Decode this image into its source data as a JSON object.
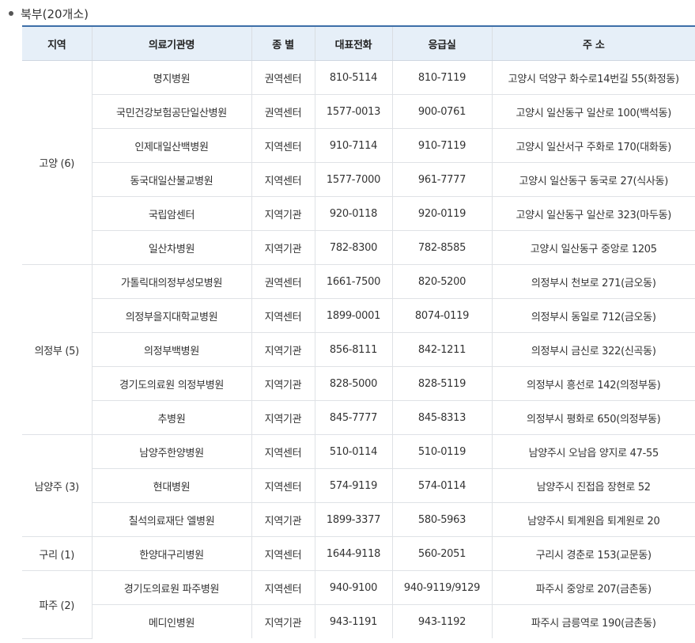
{
  "section": {
    "title": "북부(20개소)"
  },
  "table": {
    "headers": [
      "지역",
      "의료기관명",
      "종 별",
      "대표전화",
      "응급실",
      "주 소"
    ],
    "groups": [
      {
        "region": "고양 (6)",
        "rows": [
          [
            "명지병원",
            "권역센터",
            "810-5114",
            "810-7119",
            "고양시 덕양구 화수로14번길 55(화정동)"
          ],
          [
            "국민건강보험공단일산병원",
            "권역센터",
            "1577-0013",
            "900-0761",
            "고양시 일산동구 일산로 100(백석동)"
          ],
          [
            "인제대일산백병원",
            "지역센터",
            "910-7114",
            "910-7119",
            "고양시 일산서구 주화로 170(대화동)"
          ],
          [
            "동국대일산불교병원",
            "지역센터",
            "1577-7000",
            "961-7777",
            "고양시 일산동구 동국로 27(식사동)"
          ],
          [
            "국립암센터",
            "지역기관",
            "920-0118",
            "920-0119",
            "고양시 일산동구 일산로 323(마두동)"
          ],
          [
            "일산차병원",
            "지역기관",
            "782-8300",
            "782-8585",
            "고양시 일산동구 중앙로 1205"
          ]
        ]
      },
      {
        "region": "의정부 (5)",
        "rows": [
          [
            "가톨릭대의정부성모병원",
            "권역센터",
            "1661-7500",
            "820-5200",
            "의정부시 천보로 271(금오동)"
          ],
          [
            "의정부을지대학교병원",
            "지역센터",
            "1899-0001",
            "8074-0119",
            "의정부시 동일로 712(금오동)"
          ],
          [
            "의정부백병원",
            "지역기관",
            "856-8111",
            "842-1211",
            "의정부시 금신로 322(신곡동)"
          ],
          [
            "경기도의료원 의정부병원",
            "지역기관",
            "828-5000",
            "828-5119",
            "의정부시 흥선로 142(의정부동)"
          ],
          [
            "추병원",
            "지역기관",
            "845-7777",
            "845-8313",
            "의정부시 평화로 650(의정부동)"
          ]
        ]
      },
      {
        "region": "남양주 (3)",
        "rows": [
          [
            "남양주한양병원",
            "지역센터",
            "510-0114",
            "510-0119",
            "남양주시 오남읍 양지로 47-55"
          ],
          [
            "현대병원",
            "지역센터",
            "574-9119",
            "574-0114",
            "남양주시 진접읍 장현로 52"
          ],
          [
            "칠석의료재단 엘병원",
            "지역기관",
            "1899-3377",
            "580-5963",
            "남양주시 퇴계원읍 퇴계원로 20"
          ]
        ]
      },
      {
        "region": "구리 (1)",
        "rows": [
          [
            "한양대구리병원",
            "지역센터",
            "1644-9118",
            "560-2051",
            "구리시 경춘로 153(교문동)"
          ]
        ]
      },
      {
        "region": "파주 (2)",
        "rows": [
          [
            "경기도의료원 파주병원",
            "지역센터",
            "940-9100",
            "940-9119/9129",
            "파주시 중앙로 207(금촌동)"
          ],
          [
            "메디인병원",
            "지역기관",
            "943-1191",
            "943-1192",
            "파주시 금릉역로 190(금촌동)"
          ]
        ]
      }
    ]
  }
}
